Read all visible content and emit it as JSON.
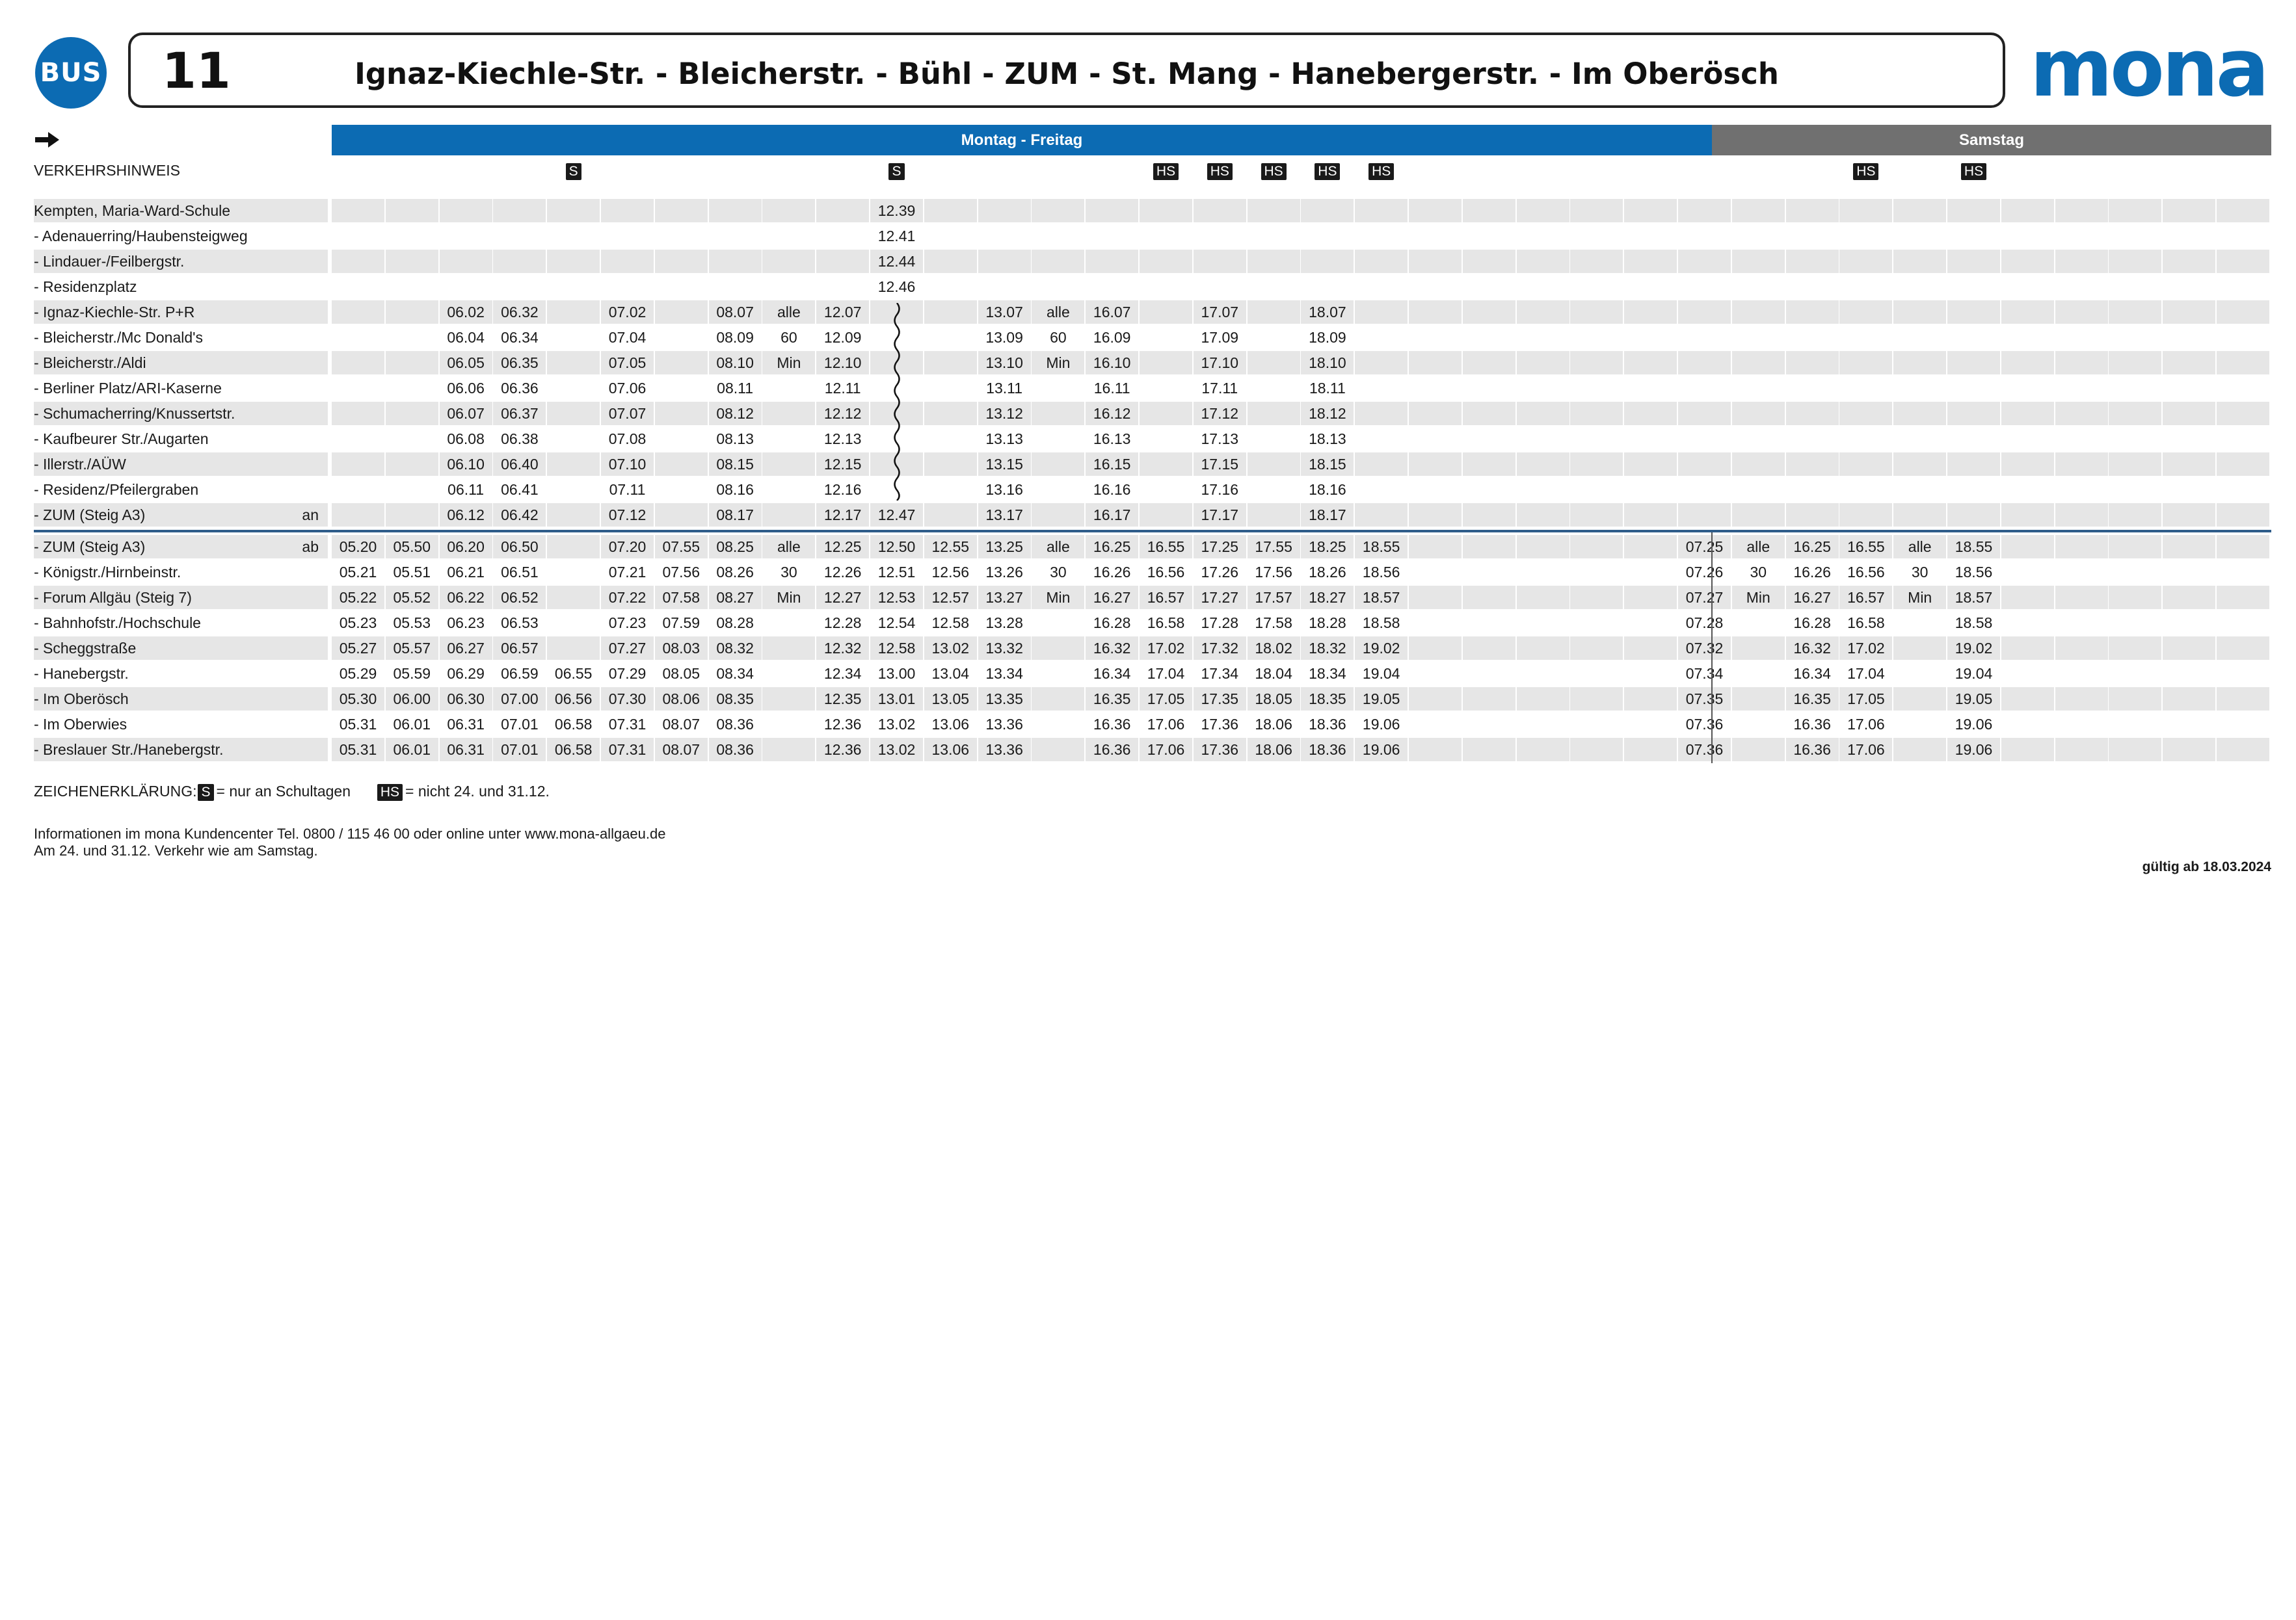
{
  "header": {
    "bus_label": "BUS",
    "line_number": "11",
    "route_title": "Ignaz-Kiechle-Str. - Bleicherstr. -  Bühl - ZUM - St. Mang - Hanebergerstr. - Im Oberösch",
    "logo_text": "mona",
    "brand_color": "#0c6bb3"
  },
  "day_bands": {
    "weekday": "Montag - Freitag",
    "saturday": "Samstag"
  },
  "direction_icon": "arrow-right-icon",
  "notice_row": {
    "label": "VERKEHRSHINWEIS",
    "marks": [
      "",
      "",
      "",
      "",
      "",
      "",
      "",
      "",
      "",
      "",
      "S",
      "",
      "",
      "",
      "",
      "",
      "",
      "",
      "",
      "",
      "",
      "",
      "",
      "",
      "",
      "",
      "",
      "",
      "",
      "",
      "",
      "",
      "",
      "",
      "",
      "",
      "",
      "",
      "",
      "",
      "",
      "",
      "",
      "",
      "",
      "",
      "",
      "",
      "",
      "",
      "",
      ""
    ]
  },
  "marks": {
    "s_badge": "S",
    "hs_badge": "HS",
    "top_s_columns": [
      4,
      10
    ],
    "top_hs_columns": [
      15,
      16,
      17,
      18,
      19,
      28,
      30
    ]
  },
  "block1": [
    {
      "stop": "Kempten, Maria-Ward-Schule",
      "suffix": "",
      "times": [
        "",
        "",
        "",
        "",
        "",
        "",
        "",
        "",
        "",
        "",
        "12.39",
        "",
        "",
        "",
        "",
        "",
        "",
        "",
        "",
        "",
        "",
        "",
        "",
        "",
        "",
        "",
        "",
        "",
        "",
        "",
        "",
        "",
        "",
        "",
        "",
        ""
      ]
    },
    {
      "stop": "- Adenauerring/Haubensteigweg",
      "suffix": "",
      "times": [
        "",
        "",
        "",
        "",
        "",
        "",
        "",
        "",
        "",
        "",
        "12.41",
        "",
        "",
        "",
        "",
        "",
        "",
        "",
        "",
        "",
        "",
        "",
        "",
        "",
        "",
        "",
        "",
        "",
        "",
        "",
        "",
        "",
        "",
        "",
        "",
        ""
      ]
    },
    {
      "stop": "- Lindauer-/Feilbergstr.",
      "suffix": "",
      "times": [
        "",
        "",
        "",
        "",
        "",
        "",
        "",
        "",
        "",
        "",
        "12.44",
        "",
        "",
        "",
        "",
        "",
        "",
        "",
        "",
        "",
        "",
        "",
        "",
        "",
        "",
        "",
        "",
        "",
        "",
        "",
        "",
        "",
        "",
        "",
        "",
        ""
      ]
    },
    {
      "stop": "- Residenzplatz",
      "suffix": "",
      "times": [
        "",
        "",
        "",
        "",
        "",
        "",
        "",
        "",
        "",
        "",
        "12.46",
        "",
        "",
        "",
        "",
        "",
        "",
        "",
        "",
        "",
        "",
        "",
        "",
        "",
        "",
        "",
        "",
        "",
        "",
        "",
        "",
        "",
        "",
        "",
        "",
        ""
      ]
    },
    {
      "stop": "- Ignaz-Kiechle-Str. P+R",
      "suffix": "",
      "times": [
        "",
        "",
        "06.02",
        "06.32",
        "",
        "07.02",
        "",
        "08.07",
        "alle",
        "12.07",
        "",
        "",
        "13.07",
        "alle",
        "16.07",
        "",
        "17.07",
        "",
        "18.07",
        "",
        "",
        "",
        "",
        "",
        "",
        "",
        "",
        "",
        "",
        "",
        "",
        "",
        "",
        "",
        "",
        ""
      ]
    },
    {
      "stop": "- Bleicherstr./Mc Donald's",
      "suffix": "",
      "times": [
        "",
        "",
        "06.04",
        "06.34",
        "",
        "07.04",
        "",
        "08.09",
        "60",
        "12.09",
        "",
        "",
        "13.09",
        "60",
        "16.09",
        "",
        "17.09",
        "",
        "18.09",
        "",
        "",
        "",
        "",
        "",
        "",
        "",
        "",
        "",
        "",
        "",
        "",
        "",
        "",
        "",
        "",
        ""
      ]
    },
    {
      "stop": "- Bleicherstr./Aldi",
      "suffix": "",
      "times": [
        "",
        "",
        "06.05",
        "06.35",
        "",
        "07.05",
        "",
        "08.10",
        "Min",
        "12.10",
        "",
        "",
        "13.10",
        "Min",
        "16.10",
        "",
        "17.10",
        "",
        "18.10",
        "",
        "",
        "",
        "",
        "",
        "",
        "",
        "",
        "",
        "",
        "",
        "",
        "",
        "",
        "",
        "",
        ""
      ]
    },
    {
      "stop": "- Berliner Platz/ARI-Kaserne",
      "suffix": "",
      "times": [
        "",
        "",
        "06.06",
        "06.36",
        "",
        "07.06",
        "",
        "08.11",
        "",
        "12.11",
        "",
        "",
        "13.11",
        "",
        "16.11",
        "",
        "17.11",
        "",
        "18.11",
        "",
        "",
        "",
        "",
        "",
        "",
        "",
        "",
        "",
        "",
        "",
        "",
        "",
        "",
        "",
        "",
        ""
      ]
    },
    {
      "stop": "- Schumacherring/Knussertstr.",
      "suffix": "",
      "times": [
        "",
        "",
        "06.07",
        "06.37",
        "",
        "07.07",
        "",
        "08.12",
        "",
        "12.12",
        "",
        "",
        "13.12",
        "",
        "16.12",
        "",
        "17.12",
        "",
        "18.12",
        "",
        "",
        "",
        "",
        "",
        "",
        "",
        "",
        "",
        "",
        "",
        "",
        "",
        "",
        "",
        "",
        ""
      ]
    },
    {
      "stop": "- Kaufbeurer Str./Augarten",
      "suffix": "",
      "times": [
        "",
        "",
        "06.08",
        "06.38",
        "",
        "07.08",
        "",
        "08.13",
        "",
        "12.13",
        "",
        "",
        "13.13",
        "",
        "16.13",
        "",
        "17.13",
        "",
        "18.13",
        "",
        "",
        "",
        "",
        "",
        "",
        "",
        "",
        "",
        "",
        "",
        "",
        "",
        "",
        "",
        "",
        ""
      ]
    },
    {
      "stop": "- Illerstr./AÜW",
      "suffix": "",
      "times": [
        "",
        "",
        "06.10",
        "06.40",
        "",
        "07.10",
        "",
        "08.15",
        "",
        "12.15",
        "",
        "",
        "13.15",
        "",
        "16.15",
        "",
        "17.15",
        "",
        "18.15",
        "",
        "",
        "",
        "",
        "",
        "",
        "",
        "",
        "",
        "",
        "",
        "",
        "",
        "",
        "",
        "",
        ""
      ]
    },
    {
      "stop": "- Residenz/Pfeilergraben",
      "suffix": "",
      "times": [
        "",
        "",
        "06.11",
        "06.41",
        "",
        "07.11",
        "",
        "08.16",
        "",
        "12.16",
        "",
        "",
        "13.16",
        "",
        "16.16",
        "",
        "17.16",
        "",
        "18.16",
        "",
        "",
        "",
        "",
        "",
        "",
        "",
        "",
        "",
        "",
        "",
        "",
        "",
        "",
        "",
        "",
        ""
      ]
    },
    {
      "stop": "- ZUM (Steig A3)",
      "suffix": "an",
      "times": [
        "",
        "",
        "06.12",
        "06.42",
        "",
        "07.12",
        "",
        "08.17",
        "",
        "12.17",
        "12.47",
        "",
        "13.17",
        "",
        "16.17",
        "",
        "17.17",
        "",
        "18.17",
        "",
        "",
        "",
        "",
        "",
        "",
        "",
        "",
        "",
        "",
        "",
        "",
        "",
        "",
        "",
        "",
        ""
      ]
    }
  ],
  "block2": [
    {
      "stop": "- ZUM (Steig A3)",
      "suffix": "ab",
      "times": [
        "05.20",
        "05.50",
        "06.20",
        "06.50",
        "",
        "07.20",
        "07.55",
        "08.25",
        "alle",
        "12.25",
        "12.50",
        "12.55",
        "13.25",
        "alle",
        "16.25",
        "16.55",
        "17.25",
        "17.55",
        "18.25",
        "18.55",
        "",
        "",
        "",
        "",
        "",
        "07.25",
        "alle",
        "16.25",
        "16.55",
        "alle",
        "18.55",
        "",
        "",
        "",
        "",
        ""
      ]
    },
    {
      "stop": "- Königstr./Hirnbeinstr.",
      "suffix": "",
      "times": [
        "05.21",
        "05.51",
        "06.21",
        "06.51",
        "",
        "07.21",
        "07.56",
        "08.26",
        "30",
        "12.26",
        "12.51",
        "12.56",
        "13.26",
        "30",
        "16.26",
        "16.56",
        "17.26",
        "17.56",
        "18.26",
        "18.56",
        "",
        "",
        "",
        "",
        "",
        "07.26",
        "30",
        "16.26",
        "16.56",
        "30",
        "18.56",
        "",
        "",
        "",
        "",
        ""
      ]
    },
    {
      "stop": "- Forum Allgäu (Steig 7)",
      "suffix": "",
      "times": [
        "05.22",
        "05.52",
        "06.22",
        "06.52",
        "",
        "07.22",
        "07.58",
        "08.27",
        "Min",
        "12.27",
        "12.53",
        "12.57",
        "13.27",
        "Min",
        "16.27",
        "16.57",
        "17.27",
        "17.57",
        "18.27",
        "18.57",
        "",
        "",
        "",
        "",
        "",
        "07.27",
        "Min",
        "16.27",
        "16.57",
        "Min",
        "18.57",
        "",
        "",
        "",
        "",
        ""
      ]
    },
    {
      "stop": "- Bahnhofstr./Hochschule",
      "suffix": "",
      "times": [
        "05.23",
        "05.53",
        "06.23",
        "06.53",
        "",
        "07.23",
        "07.59",
        "08.28",
        "",
        "12.28",
        "12.54",
        "12.58",
        "13.28",
        "",
        "16.28",
        "16.58",
        "17.28",
        "17.58",
        "18.28",
        "18.58",
        "",
        "",
        "",
        "",
        "",
        "07.28",
        "",
        "16.28",
        "16.58",
        "",
        "18.58",
        "",
        "",
        "",
        "",
        ""
      ]
    },
    {
      "stop": "- Scheggstraße",
      "suffix": "",
      "times": [
        "05.27",
        "05.57",
        "06.27",
        "06.57",
        "",
        "07.27",
        "08.03",
        "08.32",
        "",
        "12.32",
        "12.58",
        "13.02",
        "13.32",
        "",
        "16.32",
        "17.02",
        "17.32",
        "18.02",
        "18.32",
        "19.02",
        "",
        "",
        "",
        "",
        "",
        "07.32",
        "",
        "16.32",
        "17.02",
        "",
        "19.02",
        "",
        "",
        "",
        "",
        ""
      ]
    },
    {
      "stop": "- Hanebergstr.",
      "suffix": "",
      "times": [
        "05.29",
        "05.59",
        "06.29",
        "06.59",
        "06.55",
        "07.29",
        "08.05",
        "08.34",
        "",
        "12.34",
        "13.00",
        "13.04",
        "13.34",
        "",
        "16.34",
        "17.04",
        "17.34",
        "18.04",
        "18.34",
        "19.04",
        "",
        "",
        "",
        "",
        "",
        "07.34",
        "",
        "16.34",
        "17.04",
        "",
        "19.04",
        "",
        "",
        "",
        "",
        ""
      ]
    },
    {
      "stop": "- Im Oberösch",
      "suffix": "",
      "times": [
        "05.30",
        "06.00",
        "06.30",
        "07.00",
        "06.56",
        "07.30",
        "08.06",
        "08.35",
        "",
        "12.35",
        "13.01",
        "13.05",
        "13.35",
        "",
        "16.35",
        "17.05",
        "17.35",
        "18.05",
        "18.35",
        "19.05",
        "",
        "",
        "",
        "",
        "",
        "07.35",
        "",
        "16.35",
        "17.05",
        "",
        "19.05",
        "",
        "",
        "",
        "",
        ""
      ]
    },
    {
      "stop": "- Im Oberwies",
      "suffix": "",
      "times": [
        "05.31",
        "06.01",
        "06.31",
        "07.01",
        "06.58",
        "07.31",
        "08.07",
        "08.36",
        "",
        "12.36",
        "13.02",
        "13.06",
        "13.36",
        "",
        "16.36",
        "17.06",
        "17.36",
        "18.06",
        "18.36",
        "19.06",
        "",
        "",
        "",
        "",
        "",
        "07.36",
        "",
        "16.36",
        "17.06",
        "",
        "19.06",
        "",
        "",
        "",
        "",
        ""
      ]
    },
    {
      "stop": "- Breslauer Str./Hanebergstr.",
      "suffix": "",
      "times": [
        "05.31",
        "06.01",
        "06.31",
        "07.01",
        "06.58",
        "07.31",
        "08.07",
        "08.36",
        "",
        "12.36",
        "13.02",
        "13.06",
        "13.36",
        "",
        "16.36",
        "17.06",
        "17.36",
        "18.06",
        "18.36",
        "19.06",
        "",
        "",
        "",
        "",
        "",
        "07.36",
        "",
        "16.36",
        "17.06",
        "",
        "19.06",
        "",
        "",
        "",
        "",
        ""
      ]
    }
  ],
  "footer": {
    "legend_label": "ZEICHENERKLÄRUNG:",
    "legend_s_text": "= nur an Schultagen",
    "legend_hs_text": "= nicht 24. und 31.12.",
    "info_line1": "Informationen im mona Kundencenter Tel. 0800 / 115 46 00 oder online unter www.mona-allgaeu.de",
    "info_line2": "Am 24. und 31.12. Verkehr wie am Samstag.",
    "valid_from": "gültig ab 18.03.2024"
  }
}
